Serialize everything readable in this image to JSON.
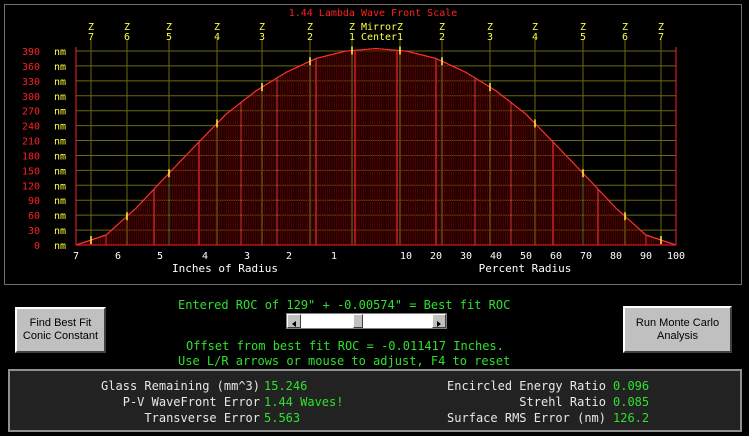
{
  "plot": {
    "title": "1.44 Lambda Wave Front Scale",
    "mirror_label": "Mirror",
    "center_label": "Center",
    "zones_left": [
      {
        "z": "Z",
        "n": "7"
      },
      {
        "z": "Z",
        "n": "6"
      },
      {
        "z": "Z",
        "n": "5"
      },
      {
        "z": "Z",
        "n": "4"
      },
      {
        "z": "Z",
        "n": "3"
      },
      {
        "z": "Z",
        "n": "2"
      },
      {
        "z": "Z",
        "n": "1"
      }
    ],
    "zones_right": [
      {
        "z": "Z",
        "n": "1"
      },
      {
        "z": "Z",
        "n": "2"
      },
      {
        "z": "Z",
        "n": "3"
      },
      {
        "z": "Z",
        "n": "4"
      },
      {
        "z": "Z",
        "n": "5"
      },
      {
        "z": "Z",
        "n": "6"
      },
      {
        "z": "Z",
        "n": "7"
      }
    ],
    "y_tick_labels": [
      "390 nm",
      "360 nm",
      "330 nm",
      "300 nm",
      "270 nm",
      "240 nm",
      "210 nm",
      "180 nm",
      "150 nm",
      "120 nm",
      "90 nm",
      "60 nm",
      "30 nm",
      "0 nm"
    ],
    "x_left_ticks": [
      "7",
      "6",
      "5",
      "4",
      "3",
      "2",
      "1"
    ],
    "x_right_ticks": [
      "10",
      "20",
      "30",
      "40",
      "50",
      "60",
      "70",
      "80",
      "90",
      "100"
    ],
    "x_left_label": "Inches of Radius",
    "x_right_label": "Percent Radius",
    "colors": {
      "axis_red": "#ff2020",
      "curve_red": "#ff3030",
      "zone_yellow": "#ffff40",
      "fill_dark_red": "#5a0000",
      "grid_olive": "#6a6a10"
    }
  },
  "chart_data": {
    "type": "area",
    "title": "1.44 Lambda Wave Front Scale",
    "xlabel": "Percent Radius",
    "ylabel": "",
    "ylim": [
      0,
      390
    ],
    "x": [
      -100,
      -90,
      -80,
      -70,
      -60,
      -50,
      -40,
      -30,
      -20,
      -10,
      0,
      10,
      20,
      30,
      40,
      50,
      60,
      70,
      80,
      90,
      100
    ],
    "values": [
      0,
      20,
      74,
      138,
      201,
      263,
      310,
      347,
      375,
      390,
      395,
      390,
      375,
      347,
      310,
      263,
      201,
      138,
      74,
      20,
      0
    ],
    "y_unit": "nm"
  },
  "buttons": {
    "find_best_fit": "Find Best Fit Conic Constant",
    "run_monte_carlo": "Run Monte Carlo Analysis"
  },
  "info": {
    "entered_roc": "Entered ROC of 129\" + -0.00574\" = Best fit ROC",
    "offset": "Offset from best fit ROC = -0.011417 Inches.",
    "hint": "Use L/R arrows or mouse to adjust, F4 to reset"
  },
  "slider": {
    "position_fraction": 0.43
  },
  "stats": {
    "glass_label": "Glass Remaining (mm^3)",
    "glass_value": "15.246",
    "pv_label": "P-V WaveFront Error",
    "pv_value": "1.44 Waves!",
    "transverse_label": "Transverse Error",
    "transverse_value": "5.563",
    "encircled_label": "Encircled Energy Ratio",
    "encircled_value": "0.096",
    "strehl_label": "Strehl Ratio",
    "strehl_value": "0.085",
    "rms_label": "Surface RMS Error (nm)",
    "rms_value": "126.2"
  }
}
